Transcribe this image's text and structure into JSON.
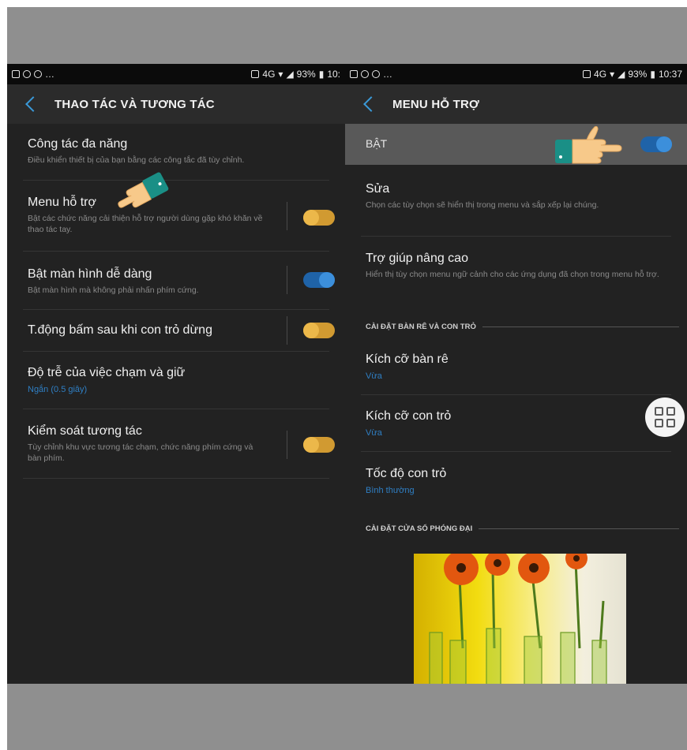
{
  "left": {
    "status": {
      "battery": "93%",
      "time": "10:",
      "signal": "4G"
    },
    "header": {
      "title": "THAO TÁC VÀ TƯƠNG TÁC"
    },
    "items": [
      {
        "title": "Công tác đa năng",
        "subtitle": "Điều khiển thiết bị của bạn bằng các công tắc đã tùy chỉnh."
      },
      {
        "title": "Menu hỗ trợ",
        "subtitle": "Bật các chức năng cải thiện hỗ trợ người dùng gặp khó khăn về thao tác tay.",
        "toggle": "off"
      },
      {
        "title": "Bật màn hình dễ dàng",
        "subtitle": "Bật màn hình mà không phải nhấn phím cứng.",
        "toggle": "on"
      },
      {
        "title": "T.động bấm sau khi con trỏ dừng",
        "toggle": "off"
      },
      {
        "title": "Độ trễ của việc chạm và giữ",
        "value": "Ngắn (0.5 giây)"
      },
      {
        "title": "Kiểm soát tương tác",
        "subtitle": "Tùy chỉnh khu vực tương tác chạm, chức năng phím cứng và bàn phím.",
        "toggle": "off"
      }
    ]
  },
  "right": {
    "status": {
      "battery": "93%",
      "time": "10:37",
      "signal": "4G"
    },
    "header": {
      "title": "MENU HỖ TRỢ"
    },
    "master": {
      "label": "BẬT",
      "toggle": "on"
    },
    "items": [
      {
        "title": "Sửa",
        "subtitle": "Chọn các tùy chọn sẽ hiển thị trong menu và sắp xếp lại chúng."
      },
      {
        "title": "Trợ giúp nâng cao",
        "subtitle": "Hiển thị tùy chọn menu ngữ cảnh cho các ứng dụng đã chọn trong menu hỗ trợ."
      }
    ],
    "section1": "CÀI ĐẶT BÀN RÊ VÀ CON TRỎ",
    "pointer_items": [
      {
        "title": "Kích cỡ bàn rê",
        "value": "Vừa"
      },
      {
        "title": "Kích cỡ con trỏ",
        "value": "Vừa"
      },
      {
        "title": "Tốc độ con trỏ",
        "value": "Bình thường"
      }
    ],
    "section2": "CÀI ĐẶT CỬA SỔ PHÓNG ĐẠI"
  },
  "colors": {
    "toggle_off": "#ecb84a",
    "toggle_on": "#3c8fdb",
    "accent": "#3a9ad9",
    "background": "#222222"
  },
  "icons": [
    "back-chevron-icon",
    "pointing-hand-icon",
    "assistant-menu-grid-icon"
  ]
}
